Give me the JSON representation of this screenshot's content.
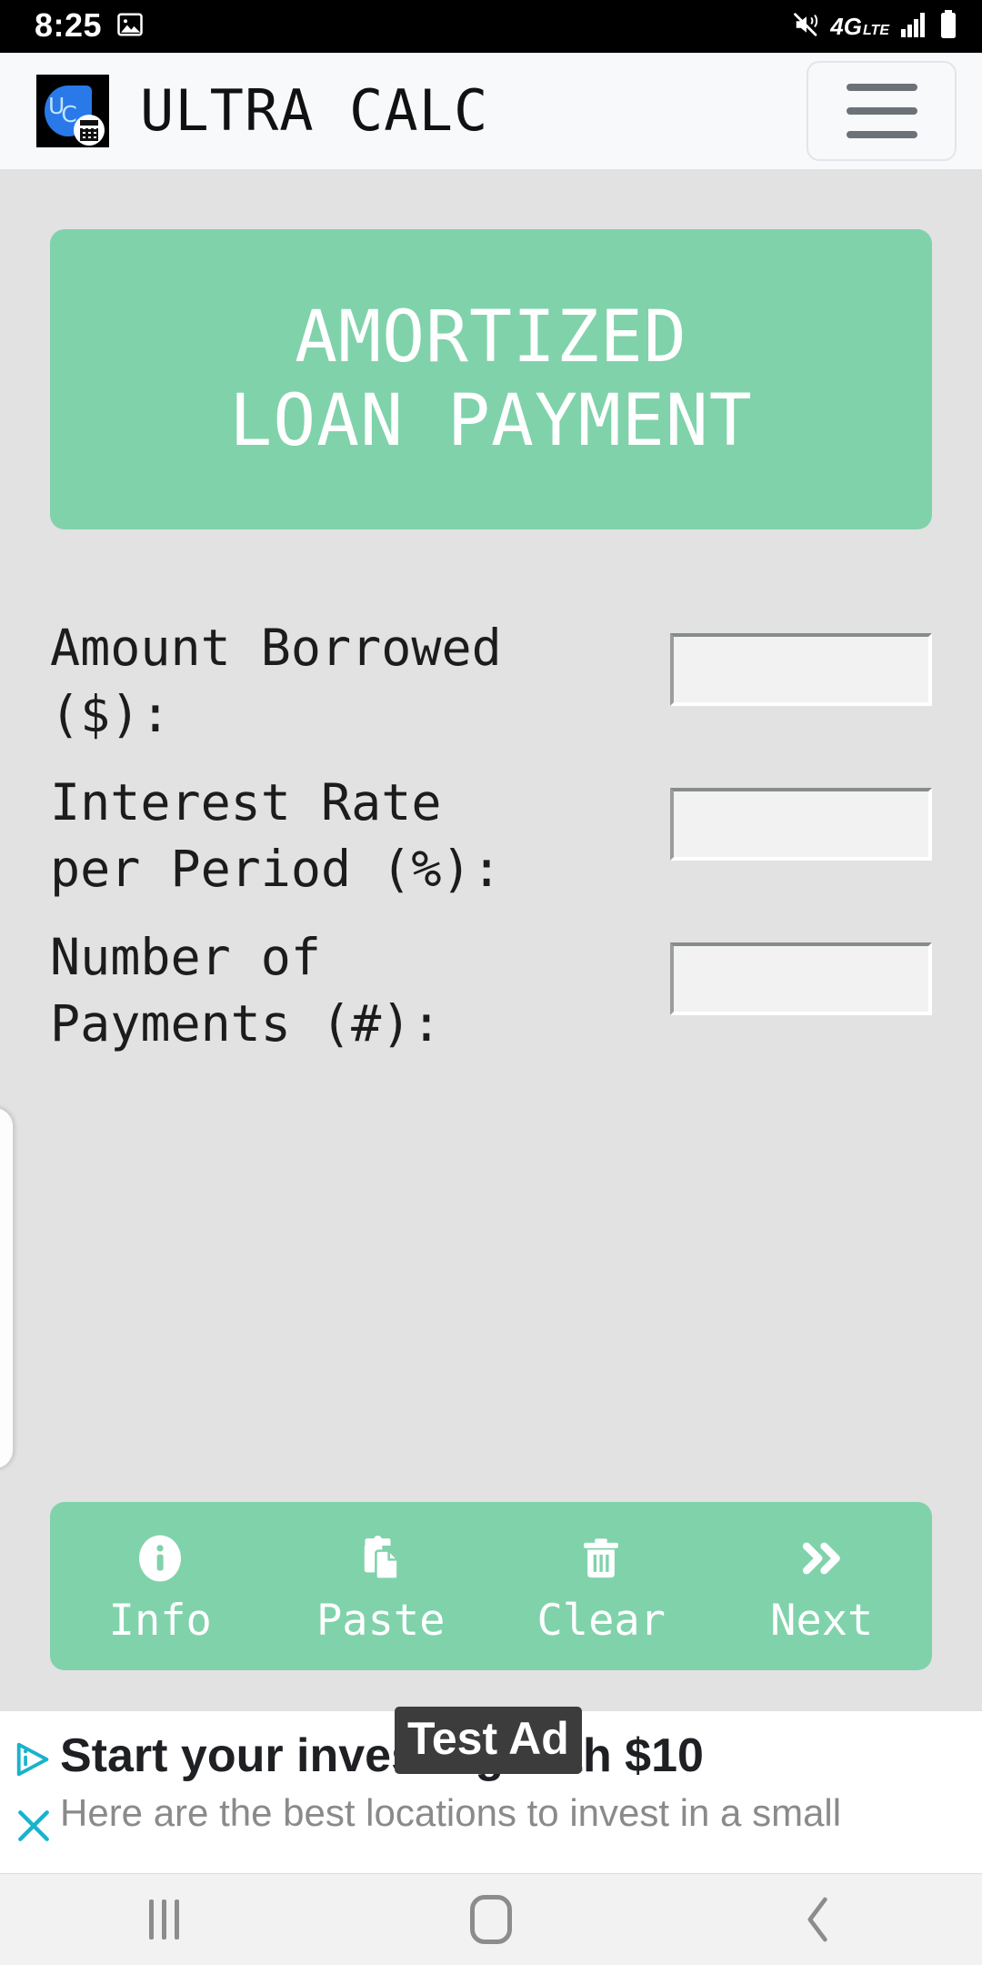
{
  "status_bar": {
    "time": "8:25",
    "left_icons": [
      "image-icon"
    ],
    "right_icons": [
      "mute-icon",
      "4g-lte-icon",
      "signal-bars-icon",
      "battery-icon"
    ],
    "network": "4G",
    "network_sub": "LTE"
  },
  "app_bar": {
    "logo_name": "ultra-calc-logo",
    "logo_letters_u": "U",
    "logo_letters_c": "C",
    "title": "ULTRA CALC",
    "menu_icon": "hamburger-menu-icon"
  },
  "main": {
    "banner_title": "AMORTIZED\nLOAN PAYMENT",
    "banner_color": "#80d2ab",
    "fields": [
      {
        "label": "Amount Borrowed\n($):",
        "value": "",
        "placeholder": "",
        "name": "amount-borrowed-input"
      },
      {
        "label": "Interest Rate\nper Period (%):",
        "value": "",
        "placeholder": "",
        "name": "interest-rate-input"
      },
      {
        "label": "Number of\nPayments (#):",
        "value": "",
        "placeholder": "",
        "name": "number-of-payments-input"
      }
    ]
  },
  "toolbar": {
    "buttons": [
      {
        "label": "Info",
        "icon": "info-circle-icon"
      },
      {
        "label": "Paste",
        "icon": "clipboard-paste-icon"
      },
      {
        "label": "Clear",
        "icon": "trash-icon"
      },
      {
        "label": "Next",
        "icon": "double-chevron-right-icon"
      }
    ]
  },
  "ad": {
    "badge": "Test Ad",
    "headline": "Start your investing with $10",
    "subtext": "Here are the best locations to invest in a small",
    "adchoices_icon": "adchoices-icon",
    "close_icon": "close-x-icon",
    "accent_color": "#18b3cc"
  },
  "nav_bar": {
    "recents_icon": "recents-icon",
    "home_icon": "home-icon",
    "back_icon": "back-icon"
  }
}
